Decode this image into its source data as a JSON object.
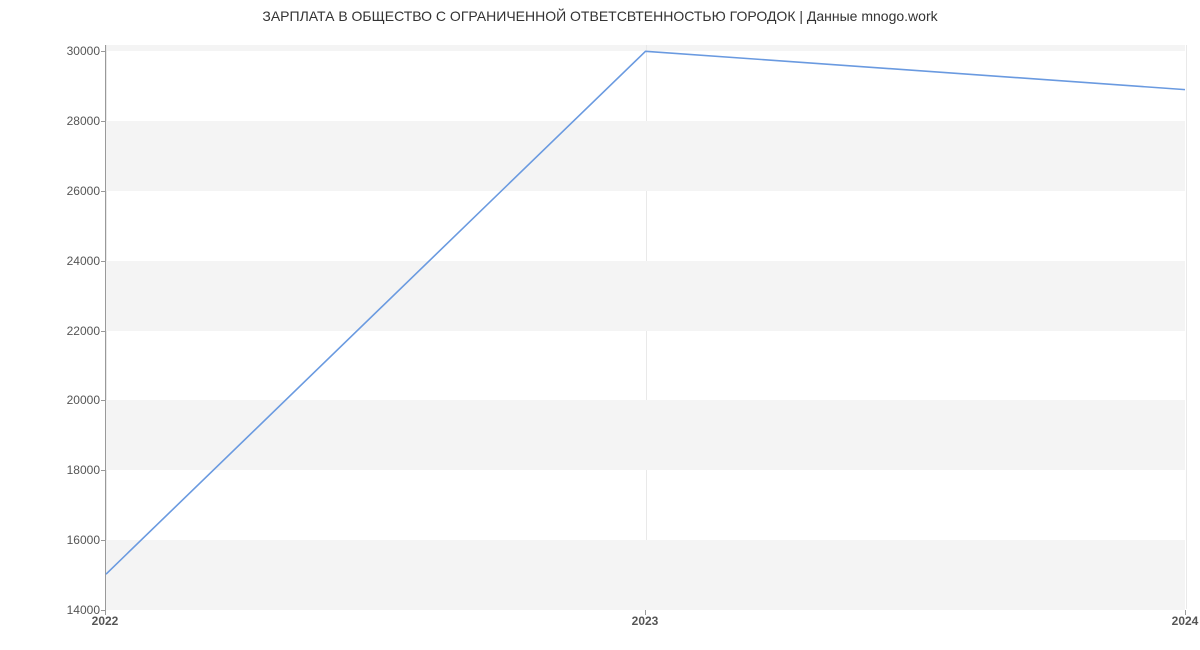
{
  "chart_data": {
    "type": "line",
    "title": "ЗАРПЛАТА В ОБЩЕСТВО С ОГРАНИЧЕННОЙ ОТВЕТСВТЕННОСТЬЮ ГОРОДОК | Данные mnogo.work",
    "xlabel": "",
    "ylabel": "",
    "x": [
      2022,
      2023,
      2024
    ],
    "values": [
      15000,
      30000,
      28900
    ],
    "x_ticks": [
      2022,
      2023,
      2024
    ],
    "y_ticks": [
      14000,
      16000,
      18000,
      20000,
      22000,
      24000,
      26000,
      28000,
      30000
    ],
    "ylim": [
      14000,
      30180
    ],
    "xlim": [
      2022,
      2024
    ],
    "line_color": "#6a9ae0",
    "band_color": "#f4f4f4"
  }
}
